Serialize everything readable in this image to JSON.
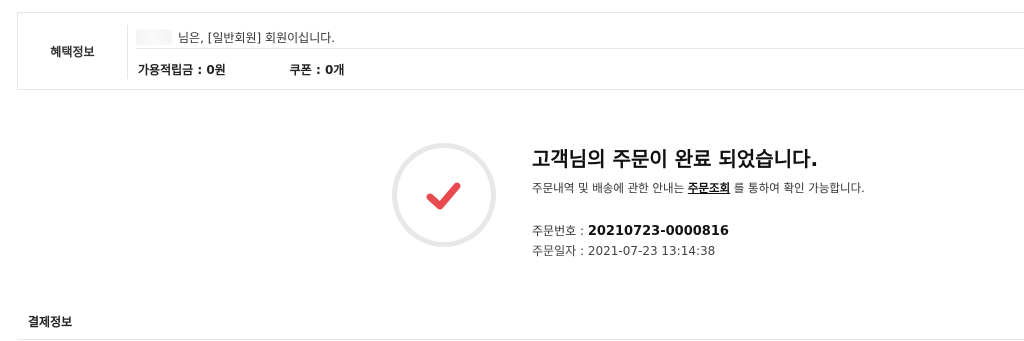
{
  "benefit": {
    "label": "혜택정보",
    "member_text": "님은, [일반회원] 회원이십니다.",
    "points_label": "가용적립금 : ",
    "points_value": "0원",
    "coupon_label": "쿠폰 : ",
    "coupon_value": "0개"
  },
  "order_complete": {
    "title": "고객님의 주문이 완료 되었습니다.",
    "guide_prefix": "주문내역 및 배송에 관한 안내는 ",
    "guide_link": "주문조회",
    "guide_suffix": " 를 통하여 확인 가능합니다.",
    "order_no_label": "주문번호 : ",
    "order_no_value": "20210723-0000816",
    "order_date_label": "주문일자 : ",
    "order_date_value": "2021-07-23 13:14:38",
    "check_color": "#e94a4f",
    "check_icon": "check-icon"
  },
  "payment": {
    "title": "결제정보"
  }
}
